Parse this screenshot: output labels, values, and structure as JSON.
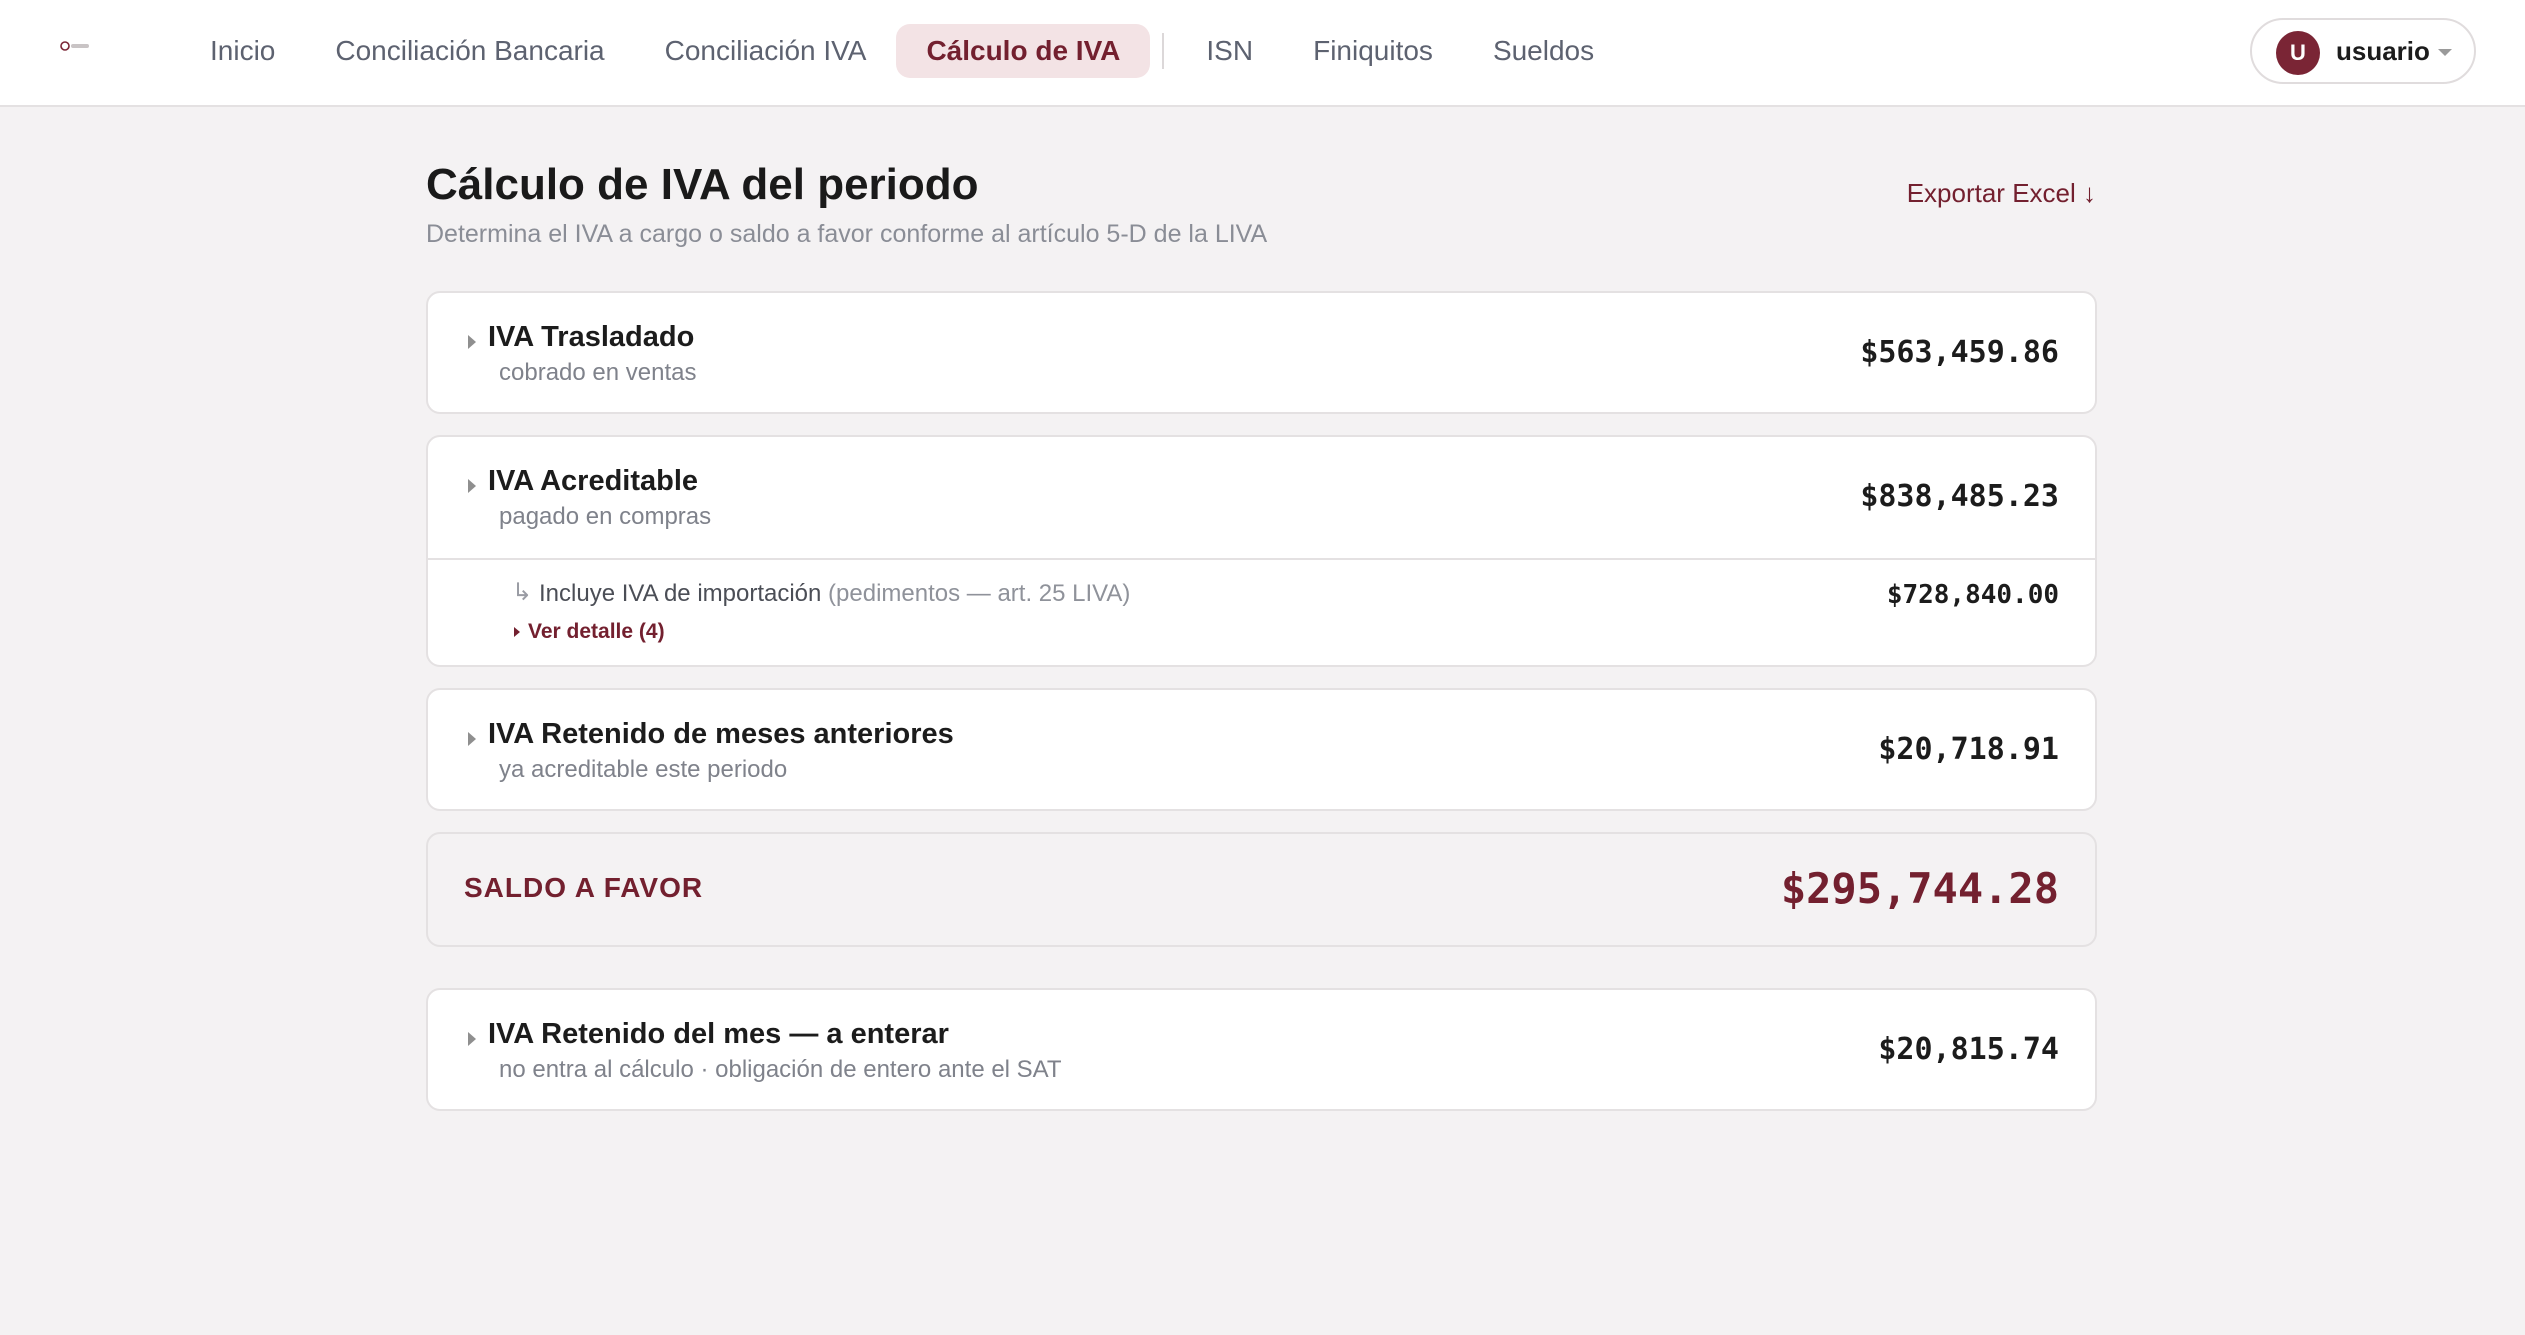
{
  "nav": {
    "items": [
      {
        "label": "Inicio"
      },
      {
        "label": "Conciliación Bancaria"
      },
      {
        "label": "Conciliación IVA"
      },
      {
        "label": "Cálculo de IVA",
        "active": true
      },
      {
        "label": "ISN"
      },
      {
        "label": "Finiquitos"
      },
      {
        "label": "Sueldos"
      }
    ]
  },
  "user": {
    "initial": "U",
    "name": "usuario"
  },
  "page": {
    "title": "Cálculo de IVA del periodo",
    "subtitle": "Determina el IVA a cargo o saldo a favor conforme al artículo 5-D de la LIVA",
    "export_label": "Exportar Excel ↓"
  },
  "cards": {
    "trasladado": {
      "title": "IVA Trasladado",
      "subtitle": "cobrado en ventas",
      "amount": "$563,459.86"
    },
    "acreditable": {
      "title": "IVA Acreditable",
      "subtitle": "pagado en compras",
      "amount": "$838,485.23",
      "import": {
        "arrow": "↳",
        "label": "Incluye IVA de importación",
        "note": "(pedimentos — art. 25 LIVA)",
        "amount": "$728,840.00",
        "detail_label": "Ver detalle (4)"
      }
    },
    "retenido_anteriores": {
      "title": "IVA Retenido de meses anteriores",
      "subtitle": "ya acreditable este periodo",
      "amount": "$20,718.91"
    },
    "saldo": {
      "label": "SALDO A FAVOR",
      "amount": "$295,744.28"
    },
    "retenido_mes": {
      "title": "IVA Retenido del mes — a enterar",
      "subtitle": "no entra al cálculo · obligación de entero ante el SAT",
      "amount": "$20,815.74"
    }
  },
  "colors": {
    "accent": "#73202f",
    "active_tab_bg": "#f3e3e5",
    "page_bg": "#f4f2f3"
  }
}
